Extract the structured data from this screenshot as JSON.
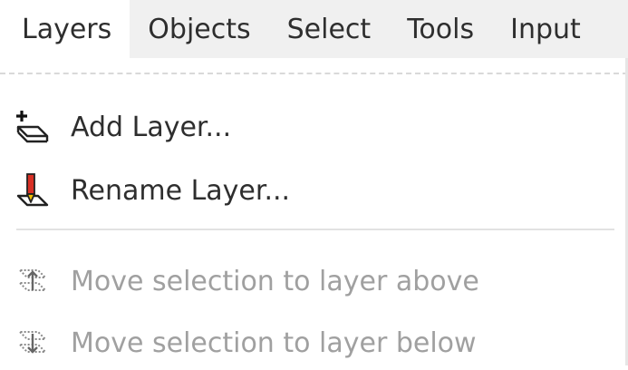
{
  "menubar": {
    "items": [
      {
        "label": "Layers",
        "active": true
      },
      {
        "label": "Objects",
        "active": false
      },
      {
        "label": "Select",
        "active": false
      },
      {
        "label": "Tools",
        "active": false
      },
      {
        "label": "Input",
        "active": false
      }
    ]
  },
  "layers_menu": {
    "items": [
      {
        "label": "Add Layer...",
        "icon": "layer-add-icon",
        "enabled": true
      },
      {
        "label": "Rename Layer...",
        "icon": "layer-rename-icon",
        "enabled": true
      },
      {
        "label": "Move selection to layer above",
        "icon": "move-to-layer-above-icon",
        "enabled": false
      },
      {
        "label": "Move selection to layer below",
        "icon": "move-to-layer-below-icon",
        "enabled": false
      }
    ]
  },
  "colors": {
    "menubar_bg": "#f0f0f0",
    "text": "#2e2e2e",
    "disabled_text": "#a0a0a0",
    "accent_red": "#d93025",
    "accent_yellow": "#f2c200"
  }
}
